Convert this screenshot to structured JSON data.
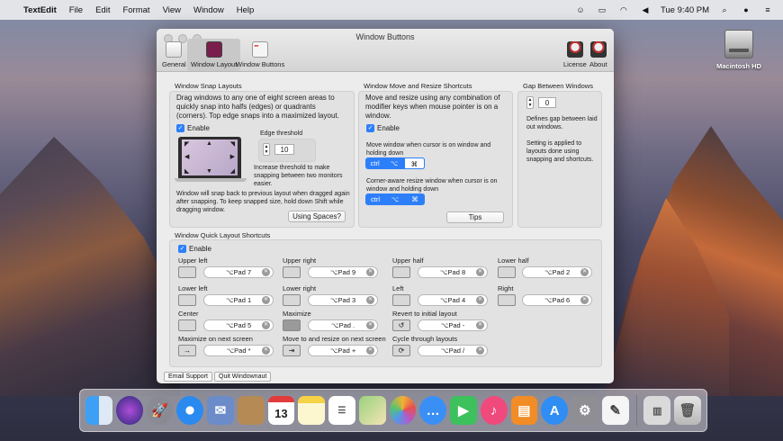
{
  "menubar": {
    "app": "TextEdit",
    "menus": [
      "File",
      "Edit",
      "Format",
      "View",
      "Window",
      "Help"
    ],
    "clock": "Tue 9:40 PM"
  },
  "desktop": {
    "hd_label": "Macintosh HD"
  },
  "window": {
    "title": "Window Buttons",
    "toolbar": [
      "General",
      "Window Layout",
      "Window Buttons"
    ],
    "toolbar_right": [
      "License",
      "About"
    ]
  },
  "snap": {
    "title": "Window Snap Layouts",
    "desc": "Drag windows to any one of eight screen areas to quickly snap into halfs (edges) or quadrants (corners). Top edge snaps into a maximized layout.",
    "enable": "Enable",
    "edge_label": "Edge threshold",
    "edge_value": "10",
    "increase_note": "Increase threshold to make snapping between two monitors easier.",
    "snapback_note": "Window will snap back to previous layout when dragged again after snapping. To keep snapped size, hold down Shift while dragging window.",
    "using_spaces": "Using Spaces?"
  },
  "move": {
    "title": "Window Move and Resize Shortcuts",
    "desc": "Move and resize using any combination of modifier keys when mouse pointer is on a window.",
    "enable": "Enable",
    "move_label": "Move window when cursor is on window and holding down",
    "resize_label": "Corner-aware resize window when cursor is on window and holding down",
    "keys": [
      "ctrl",
      "⌥",
      "⌘"
    ],
    "tips": "Tips"
  },
  "gap": {
    "title": "Gap Between Windows",
    "value": "0",
    "desc1": "Defines gap between laid out windows.",
    "desc2": "Setting is applied to layouts done using snapping and shortcuts."
  },
  "quick": {
    "title": "Window Quick Layout Shortcuts",
    "enable": "Enable",
    "items": [
      {
        "label": "Upper left",
        "key": "⌥Pad 7"
      },
      {
        "label": "Upper right",
        "key": "⌥Pad 9"
      },
      {
        "label": "Upper half",
        "key": "⌥Pad 8"
      },
      {
        "label": "Lower half",
        "key": "⌥Pad 2"
      },
      {
        "label": "Lower left",
        "key": "⌥Pad 1"
      },
      {
        "label": "Lower right",
        "key": "⌥Pad 3"
      },
      {
        "label": "Left",
        "key": "⌥Pad 4"
      },
      {
        "label": "Right",
        "key": "⌥Pad 6"
      },
      {
        "label": "Center",
        "key": "⌥Pad 5"
      },
      {
        "label": "Maximize",
        "key": "⌥Pad ."
      },
      {
        "label": "Revert to initial layout",
        "key": "⌥Pad -"
      },
      {
        "label": "Maximize on next screen",
        "key": "⌥Pad *"
      },
      {
        "label": "Move to and resize on next screen",
        "key": "⌥Pad +"
      },
      {
        "label": "Cycle through layouts",
        "key": "⌥Pad /"
      }
    ]
  },
  "footer": {
    "email": "Email Support",
    "quit": "Quit Windownaut"
  },
  "dock": {
    "apps": [
      "finder",
      "siri",
      "launchpad",
      "safari",
      "mail",
      "contacts",
      "calendar",
      "notes",
      "reminders",
      "maps",
      "photos",
      "messages",
      "facetime",
      "itunes",
      "ibooks",
      "app-store",
      "system-preferences",
      "textedit",
      "downloads",
      "trash"
    ],
    "calendar_day": "13"
  }
}
